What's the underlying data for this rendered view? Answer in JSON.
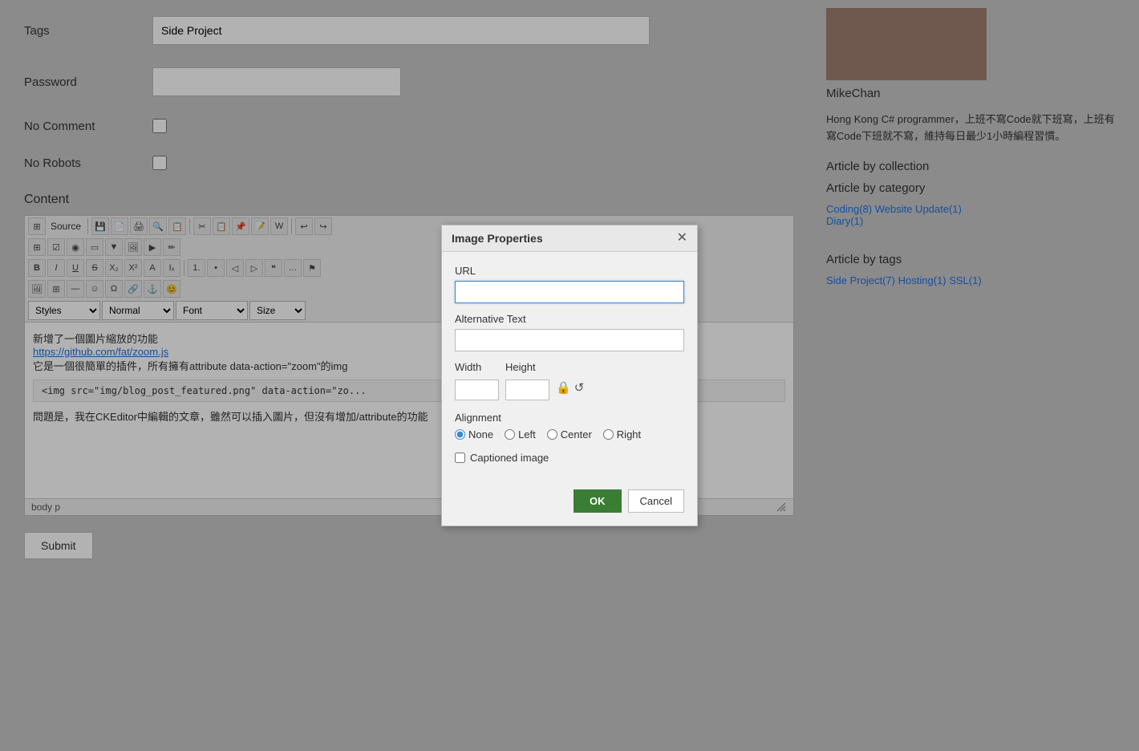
{
  "form": {
    "tags_label": "Tags",
    "tags_value": "Side Project",
    "password_label": "Password",
    "password_value": "",
    "no_comment_label": "No Comment",
    "no_robots_label": "No Robots",
    "content_label": "Content"
  },
  "toolbar": {
    "source_label": "Source",
    "styles_label": "Styles",
    "styles_options": [
      "Styles"
    ],
    "normal_label": "Normal",
    "font_label": "Font",
    "size_label": "Size"
  },
  "editor": {
    "line1": "新增了一個圖片縮放的功能",
    "link_text": "https://github.com/fat/zoom.js",
    "line2": "它是一個很簡單的插件，所有擁有attribute data-action=\"zoom\"的img",
    "code_line": "<img src=\"img/blog_post_featured.png\" data-action=\"zo...",
    "line3": "問題是，我在CKEditor中編輯的文章，雖然可以插入圖片，但沒有增加/attribute的功能",
    "statusbar": "body  p"
  },
  "sidebar": {
    "author_name": "MikeChan",
    "bio": "Hong Kong C# programmer，上班不寫Code就下班寫，上班有寫Code下班就不寫，維持每日最少1小時編程習慣。",
    "article_by_collection_title": "Article by collection",
    "article_by_category_title": "Article by category",
    "categories": [
      {
        "label": "Coding(8)",
        "href": "#"
      },
      {
        "label": "Website Update(1)",
        "href": "#"
      },
      {
        "label": "Diary(1)",
        "href": "#"
      }
    ],
    "article_by_tags_title": "Article by tags",
    "tags": [
      {
        "label": "Side Project(7)",
        "href": "#"
      },
      {
        "label": "Hosting(1)",
        "href": "#"
      },
      {
        "label": "SSL(1)",
        "href": "#"
      }
    ]
  },
  "modal": {
    "title": "Image Properties",
    "url_label": "URL",
    "url_value": "",
    "alt_text_label": "Alternative Text",
    "alt_text_value": "",
    "width_label": "Width",
    "width_value": "",
    "height_label": "Height",
    "height_value": "",
    "alignment_label": "Alignment",
    "alignment_options": [
      "None",
      "Left",
      "Center",
      "Right"
    ],
    "alignment_default": "None",
    "captioned_label": "Captioned image",
    "ok_label": "OK",
    "cancel_label": "Cancel"
  },
  "submit": {
    "label": "Submit"
  }
}
